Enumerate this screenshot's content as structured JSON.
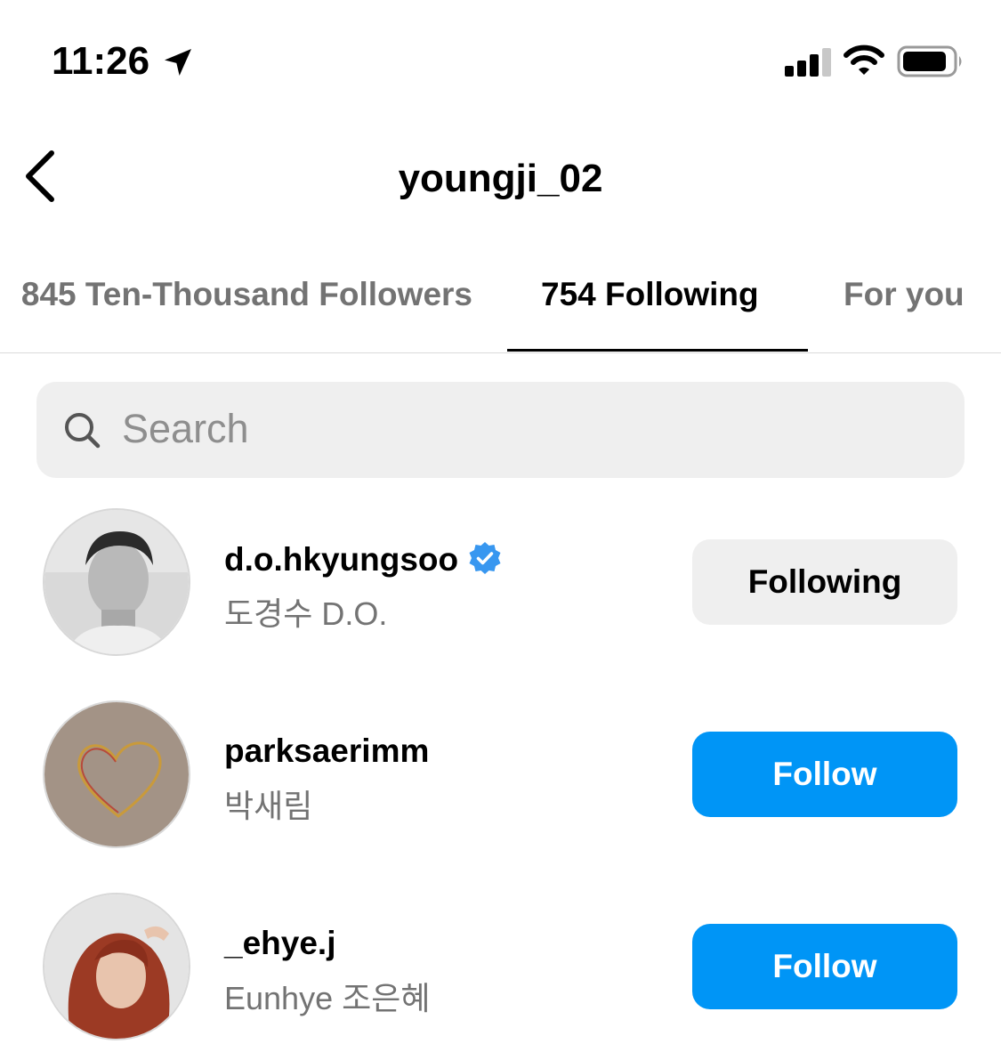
{
  "status_bar": {
    "time": "11:26",
    "icons": [
      "location-arrow-icon",
      "signal-bars-icon",
      "wifi-icon",
      "battery-icon"
    ]
  },
  "header": {
    "title": "youngji_02",
    "back_icon": "chevron-left-icon"
  },
  "tabs": [
    {
      "label": "845 Ten-Thousand Followers",
      "active": false
    },
    {
      "label": "754 Following",
      "active": true
    },
    {
      "label": "For you",
      "active": false
    }
  ],
  "search": {
    "placeholder": "Search",
    "value": ""
  },
  "users": [
    {
      "username": "d.o.hkyungsoo",
      "full_name": "도경수 D.O.",
      "verified": true,
      "button": "Following"
    },
    {
      "username": "parksaerimm",
      "full_name": "박새림",
      "verified": false,
      "button": "Follow"
    },
    {
      "username": "_ehye.j",
      "full_name": "Eunhye 조은혜",
      "verified": false,
      "button": "Follow"
    }
  ],
  "colors": {
    "follow_blue": "#0095f6",
    "verified_blue": "#3897f0",
    "secondary_text": "#737373",
    "search_bg": "#efefef"
  }
}
